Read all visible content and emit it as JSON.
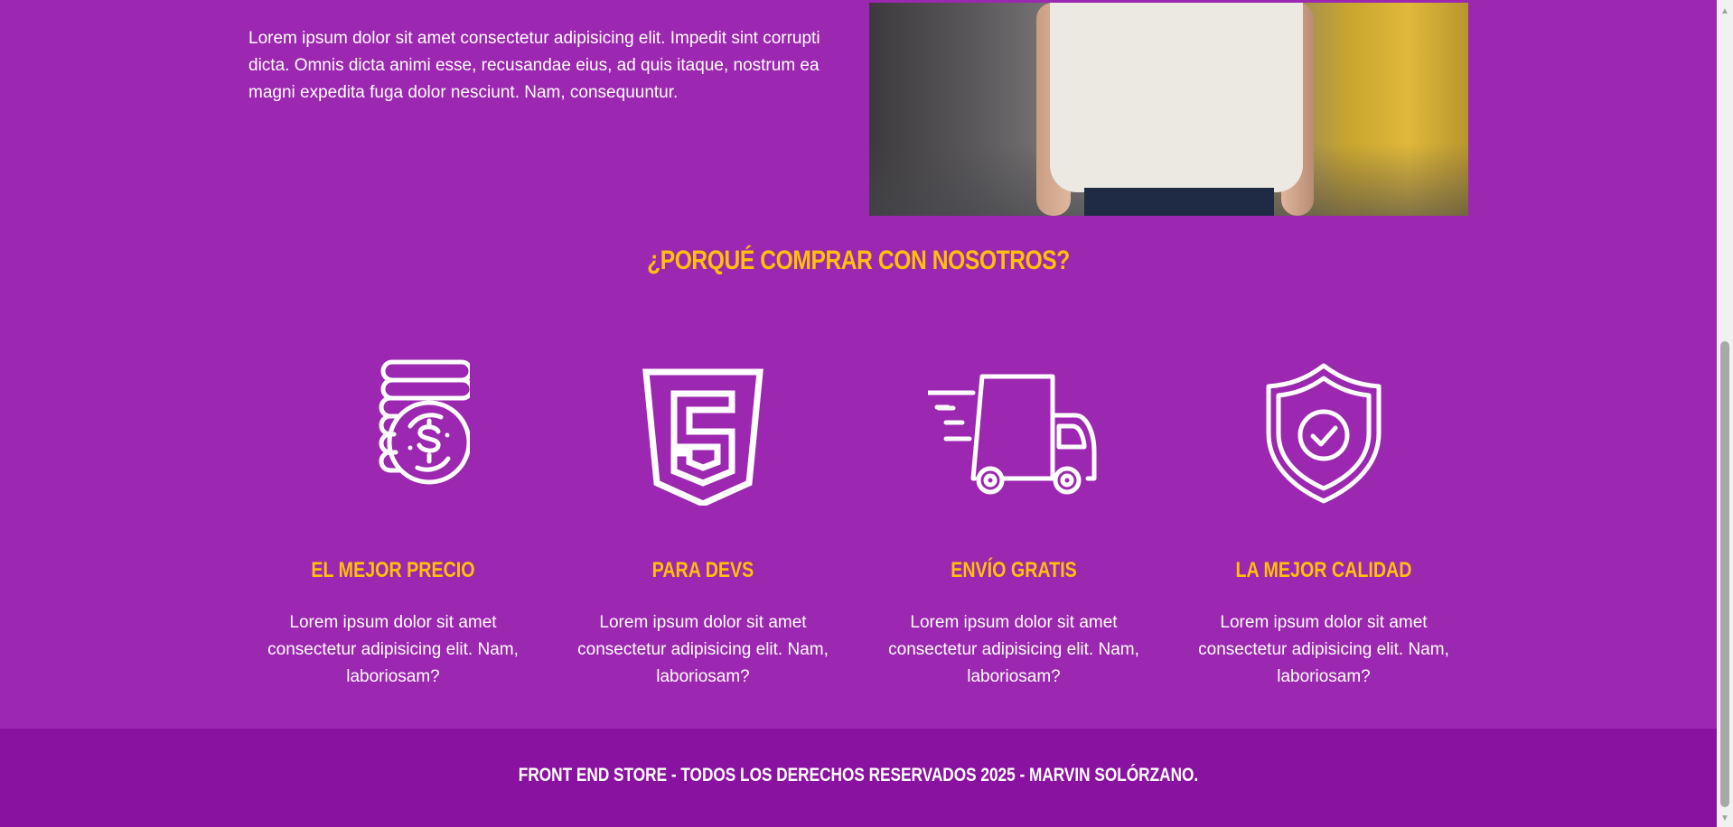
{
  "about": {
    "text": "Lorem ipsum dolor sit amet consectetur adipisicing elit. Impedit sint corrupti dicta. Omnis dicta animi esse, recusandae eius, ad quis itaque, nostrum ea magni expedita fuga dolor nesciunt. Nam, consequuntur."
  },
  "section": {
    "title": "¿Porqué comprar con nosotros?"
  },
  "features": [
    {
      "icon": "coins-dollar-icon",
      "title": "El mejor precio",
      "description": "Lorem ipsum dolor sit amet consectetur adipisicing elit. Nam, laboriosam?"
    },
    {
      "icon": "html5-icon",
      "title": "Para devs",
      "description": "Lorem ipsum dolor sit amet consectetur adipisicing elit. Nam, laboriosam?"
    },
    {
      "icon": "delivery-truck-icon",
      "title": "Envío gratis",
      "description": "Lorem ipsum dolor sit amet consectetur adipisicing elit. Nam, laboriosam?"
    },
    {
      "icon": "shield-check-icon",
      "title": "La mejor calidad",
      "description": "Lorem ipsum dolor sit amet consectetur adipisicing elit. Nam, laboriosam?"
    }
  ],
  "footer": {
    "text": "Front End Store - Todos los derechos reservados 2025 - Marvin Solórzano."
  },
  "colors": {
    "background": "#9c27b0",
    "accent": "#ffc107",
    "footer": "#8a12a0",
    "text": "#ffffff"
  }
}
